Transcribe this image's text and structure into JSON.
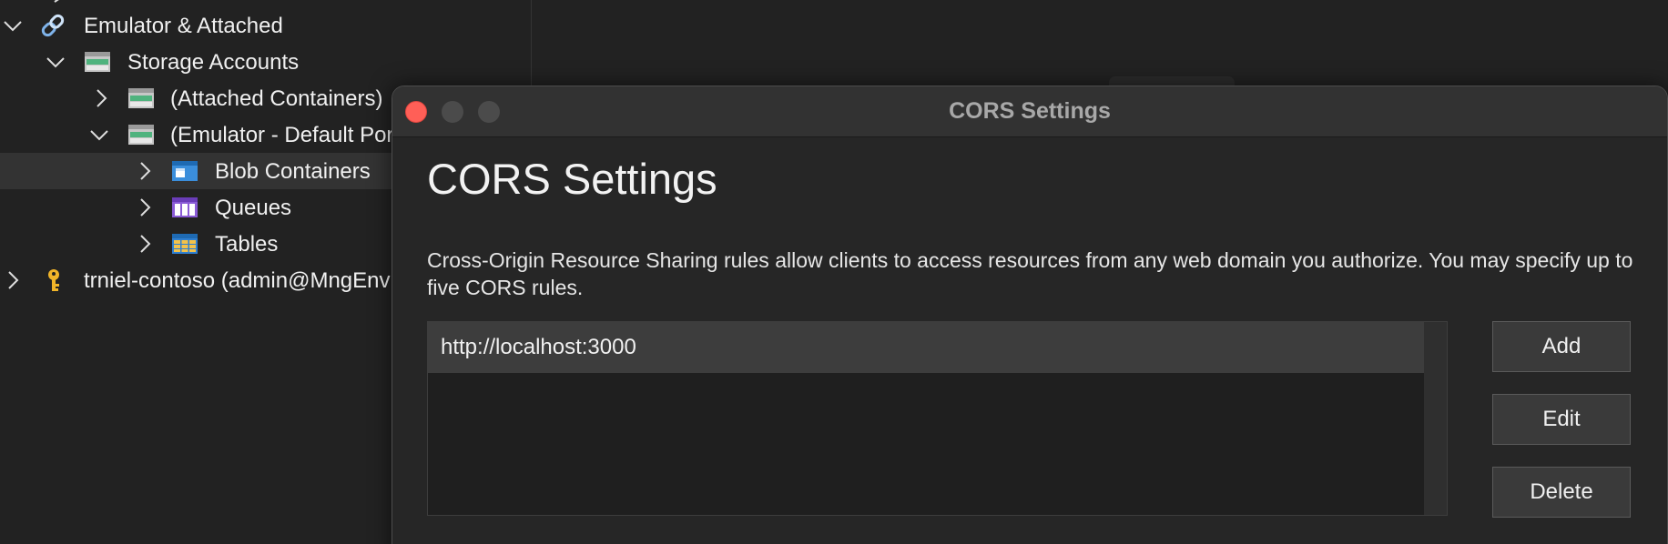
{
  "explorer": {
    "items": [
      {
        "label": "Emulator & Attached",
        "icon": "link-icon",
        "expanded": true
      },
      {
        "label": "Storage Accounts",
        "icon": "storage-accounts-icon",
        "expanded": true
      },
      {
        "label": "(Attached Containers)",
        "icon": "storage-account-icon",
        "expanded": false
      },
      {
        "label": "(Emulator - Default Por",
        "icon": "storage-account-icon",
        "expanded": true
      },
      {
        "label": "Blob Containers",
        "icon": "blob-containers-icon",
        "expanded": false,
        "selected": true
      },
      {
        "label": "Queues",
        "icon": "queues-icon",
        "expanded": false
      },
      {
        "label": "Tables",
        "icon": "tables-icon",
        "expanded": false
      },
      {
        "label": "trniel-contoso (admin@MngEnv",
        "icon": "key-icon",
        "expanded": false
      }
    ]
  },
  "dialog": {
    "window_title": "CORS Settings",
    "heading": "CORS Settings",
    "description": "Cross-Origin Resource Sharing rules allow clients to access resources from any web domain you authorize. You may specify up to five CORS rules.",
    "rules": [
      {
        "origin": "http://localhost:3000",
        "selected": true
      }
    ],
    "buttons": {
      "add": "Add",
      "edit": "Edit",
      "delete": "Delete"
    }
  },
  "colors": {
    "background": "#222222",
    "dialog_background": "#262626",
    "titlebar": "#323232",
    "close_button": "#ff5f57",
    "selected_row": "#3d3d3d",
    "text": "#f0f0f0"
  }
}
